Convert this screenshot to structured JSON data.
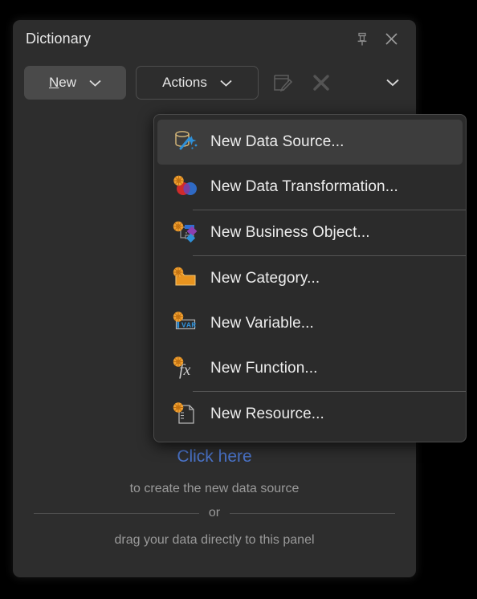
{
  "panel": {
    "title": "Dictionary",
    "title_icons": [
      {
        "name": "pin-icon",
        "label": "Pin"
      },
      {
        "name": "close-icon",
        "label": "Close"
      }
    ]
  },
  "toolbar": {
    "new_label_mnemonic": "N",
    "new_label_rest": "ew",
    "actions_label": "Actions",
    "edit_icon_label": "Edit",
    "delete_icon_label": "Delete",
    "overflow_label": "More"
  },
  "menu": {
    "items": [
      {
        "label": "New Data Source...",
        "icon": "data-source-icon",
        "selected": true,
        "separator_after": false
      },
      {
        "label": "New Data Transformation...",
        "icon": "data-transformation-icon",
        "selected": false,
        "separator_after": true
      },
      {
        "label": "New Business Object...",
        "icon": "business-object-icon",
        "selected": false,
        "separator_after": true
      },
      {
        "label": "New Category...",
        "icon": "category-icon",
        "selected": false,
        "separator_after": false
      },
      {
        "label": "New Variable...",
        "icon": "variable-icon",
        "selected": false,
        "separator_after": false
      },
      {
        "label": "New Function...",
        "icon": "function-icon",
        "selected": false,
        "separator_after": true
      },
      {
        "label": "New Resource...",
        "icon": "resource-icon",
        "selected": false,
        "separator_after": false
      }
    ]
  },
  "empty_state": {
    "link_text": "Click here",
    "subtitle": "to create the new data source",
    "or_text": "or",
    "drag_text": "drag your data directly to this panel"
  },
  "colors": {
    "background": "#000000",
    "panel_bg": "#2d2d2d",
    "menu_bg": "#2b2b2b",
    "menu_selected_bg": "#3d3d3d",
    "link_blue": "#4a73c8",
    "accent_orange": "#f0a030",
    "muted_text": "#9a9a9a",
    "primary_text": "#ededed"
  }
}
